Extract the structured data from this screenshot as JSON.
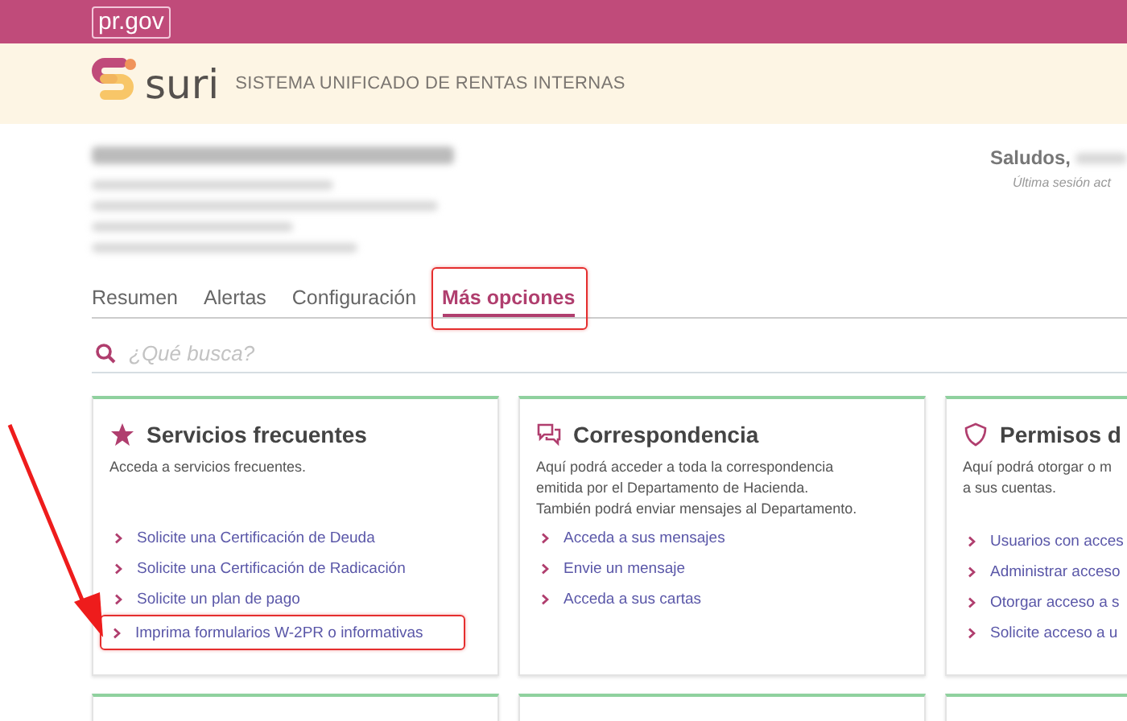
{
  "topbar": {
    "logo": "pr.gov"
  },
  "brand": {
    "name": "suri",
    "subtitle": "SISTEMA UNIFICADO DE RENTAS INTERNAS"
  },
  "user": {
    "greeting": "Saludos,",
    "last_session": "Última sesión act"
  },
  "tabs": [
    {
      "label": "Resumen",
      "selected": false,
      "highlighted": false
    },
    {
      "label": "Alertas",
      "selected": false,
      "highlighted": false
    },
    {
      "label": "Configuración",
      "selected": false,
      "highlighted": false
    },
    {
      "label": "Más opciones",
      "selected": true,
      "highlighted": true
    }
  ],
  "search": {
    "placeholder": "¿Qué busca?"
  },
  "cards": [
    {
      "kind": "star",
      "title": "Servicios frecuentes",
      "description": [
        "Acceda a servicios frecuentes."
      ],
      "links": [
        {
          "label": "Solicite una Certificación de Deuda",
          "highlighted": false
        },
        {
          "label": "Solicite una Certificación de Radicación",
          "highlighted": false
        },
        {
          "label": "Solicite un plan de pago",
          "highlighted": false
        },
        {
          "label": "Imprima formularios W-2PR o informativas",
          "highlighted": true
        }
      ]
    },
    {
      "kind": "chat",
      "title": "Correspondencia",
      "description": [
        "Aquí podrá acceder a toda la correspondencia",
        "emitida por el Departamento de Hacienda.",
        "También podrá enviar mensajes al Departamento."
      ],
      "links": [
        {
          "label": "Acceda a sus mensajes",
          "highlighted": false
        },
        {
          "label": "Envie un mensaje",
          "highlighted": false
        },
        {
          "label": "Acceda a sus cartas",
          "highlighted": false
        }
      ]
    },
    {
      "kind": "shield",
      "title": "Permisos d",
      "description": [
        "Aquí podrá otorgar o m",
        "a sus cuentas."
      ],
      "links": [
        {
          "label": "Usuarios con acces",
          "highlighted": false
        },
        {
          "label": "Administrar acceso",
          "highlighted": false
        },
        {
          "label": "Otorgar acceso a s",
          "highlighted": false
        },
        {
          "label": "Solicite acceso a u",
          "highlighted": false
        }
      ]
    }
  ],
  "annotation_arrow": true
}
